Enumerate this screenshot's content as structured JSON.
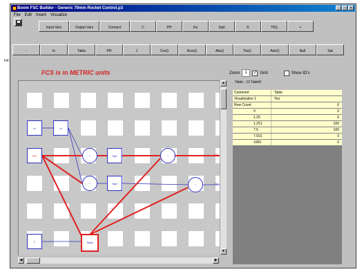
{
  "window": {
    "title": "Boom FSC Builder - Generic 70mm Rocket Control.p3"
  },
  "menu": [
    "File",
    "Edit",
    "Insert",
    "Visualize"
  ],
  "toolbar_row1": [
    "Input Vars",
    "Output Vars",
    "Connect",
    "C",
    "PH",
    "Inv",
    "Sqrt",
    "K",
    "TR()",
    "+"
  ],
  "toolbar_row2": [
    "-",
    "In",
    "Table",
    "PH",
    "J",
    "Cos()",
    "Acos()",
    "Abs()",
    "Tan()",
    "Asin()",
    "Null",
    "Sat"
  ],
  "status_tab": "Init",
  "banner": "FCS is in METRIC units",
  "zoom": {
    "label": "Zoom",
    "value": "1",
    "grid_label": "Grid",
    "grid_checked": true,
    "show_ids_label": "Show ID's",
    "show_ids_checked": false
  },
  "table_title": "Table - 13 Table8",
  "table_rows": [
    {
      "key": "Comment",
      "value": "Table"
    },
    {
      "key": "Visualization 1",
      "value": "Yes"
    },
    {
      "key": "Row Count",
      "value": "6"
    },
    {
      "key": "0",
      "value": "0"
    },
    {
      "key": "1.25",
      "value": "0"
    },
    {
      "key": "1.251",
      "value": "100"
    },
    {
      "key": "7.5",
      "value": "100"
    },
    {
      "key": "7.501",
      "value": "0"
    },
    {
      "key": "1000",
      "value": "0"
    }
  ],
  "nodes": {
    "in1": "In",
    "in2": "In",
    "ph": "PH",
    "mul1": "*",
    "mul2": "*",
    "sqrt1": "Sqrt",
    "sqrt2": "Sqrt",
    "mul3": "*",
    "mul4": "*",
    "out1": "Out",
    "out2": "Out",
    "t": "T",
    "table": "Table"
  },
  "colors": {
    "red": "#e02020",
    "blue": "#3030c0",
    "title_start": "#000080",
    "banner": "#d42020"
  }
}
